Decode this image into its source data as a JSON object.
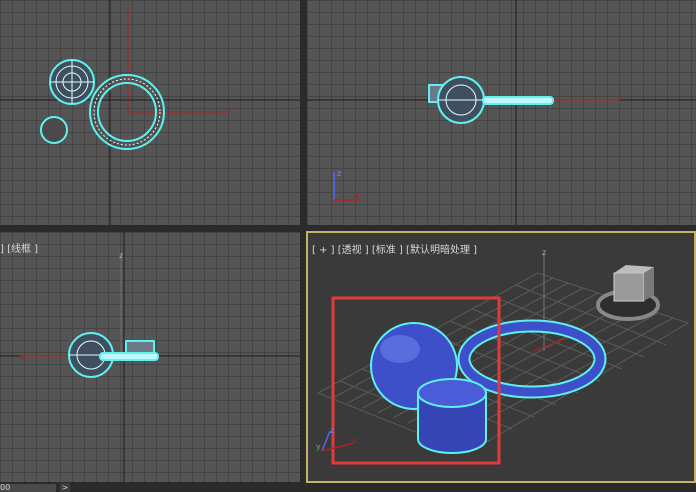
{
  "viewports": {
    "top": {
      "label": ""
    },
    "front": {
      "label": ""
    },
    "left": {
      "label": "] [线框 ]"
    },
    "perspective": {
      "label": "[ + ] [透视 ] [标准 ] [默认明暗处理 ]"
    }
  },
  "axes": {
    "x": "x",
    "y": "y",
    "z": "z"
  },
  "statusbar": {
    "field_value": "00",
    "arrow": ">"
  },
  "colors": {
    "selection_wire": "#5ff0f0",
    "object_blue": "#3d4fc9",
    "axis_red": "#b02020",
    "highlight_rect": "#e03a3a",
    "active_border": "#c8b26a"
  }
}
